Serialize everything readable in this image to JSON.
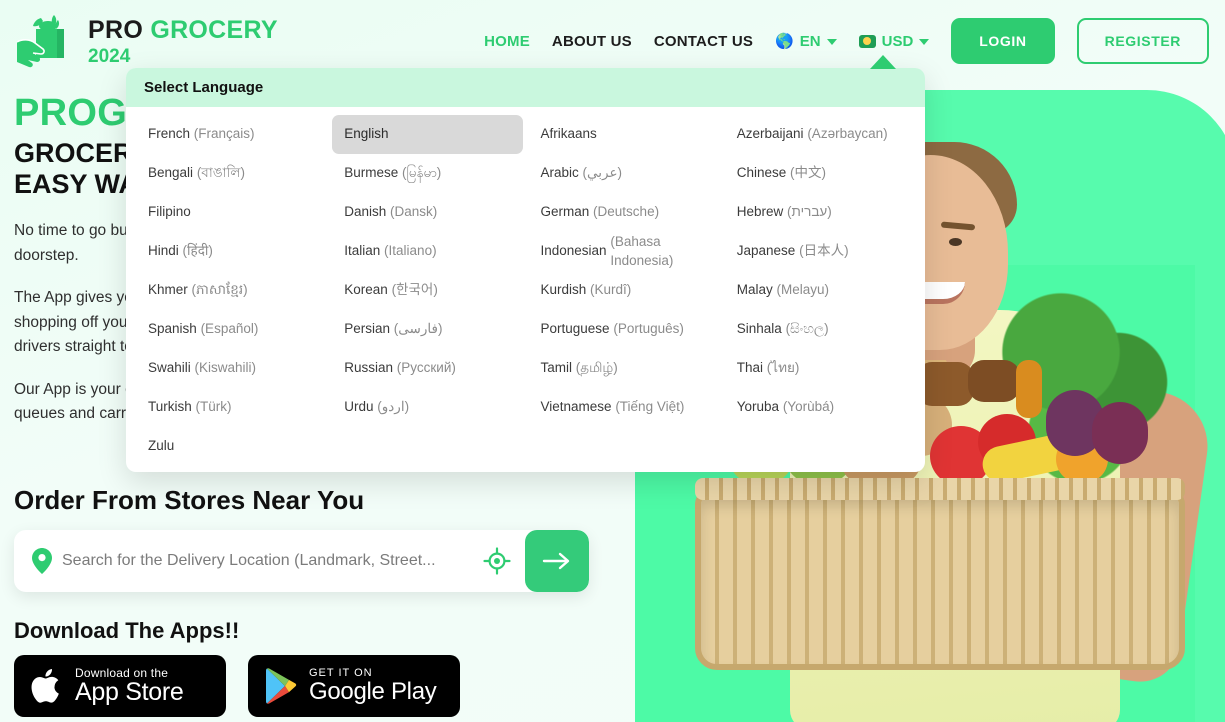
{
  "brand": {
    "logo_icon": "grocery-bag-handshake-icon",
    "name_part1": "PRO",
    "name_part2": "GROCERY",
    "year": "2024"
  },
  "nav": {
    "links": [
      {
        "label": "HOME",
        "active": true
      },
      {
        "label": "ABOUT US",
        "active": false
      },
      {
        "label": "CONTACT US",
        "active": false
      }
    ],
    "language_selector": {
      "icon": "globe-icon",
      "value": "EN",
      "caret": "chevron-down-icon"
    },
    "currency_selector": {
      "icon": "coin-icon",
      "value": "USD",
      "caret": "chevron-down-icon"
    },
    "login_label": "LOGIN",
    "register_label": "REGISTER"
  },
  "language_dropdown": {
    "title": "Select Language",
    "selected": "English",
    "items": [
      {
        "name": "French",
        "native": "(Français)"
      },
      {
        "name": "English",
        "native": ""
      },
      {
        "name": "Afrikaans",
        "native": ""
      },
      {
        "name": "Azerbaijani",
        "native": "(Azərbaycan)"
      },
      {
        "name": "Bengali",
        "native": "(বাঙালি)"
      },
      {
        "name": "Burmese",
        "native": "(မြန်မာ)"
      },
      {
        "name": "Arabic",
        "native": "(عربي)"
      },
      {
        "name": "Chinese",
        "native": "(中文)"
      },
      {
        "name": "Filipino",
        "native": ""
      },
      {
        "name": "Danish",
        "native": "(Dansk)"
      },
      {
        "name": "German",
        "native": "(Deutsche)"
      },
      {
        "name": "Hebrew",
        "native": "(עברית)"
      },
      {
        "name": "Hindi",
        "native": "(हिंदी)"
      },
      {
        "name": "Italian",
        "native": "(Italiano)"
      },
      {
        "name": "Indonesian",
        "native": "(Bahasa Indonesia)"
      },
      {
        "name": "Japanese",
        "native": "(日本人)"
      },
      {
        "name": "Khmer",
        "native": "(ភាសាខ្មែរ)"
      },
      {
        "name": "Korean",
        "native": "(한국어)"
      },
      {
        "name": "Kurdish",
        "native": "(Kurdî)"
      },
      {
        "name": "Malay",
        "native": "(Melayu)"
      },
      {
        "name": "Spanish",
        "native": "(Español)"
      },
      {
        "name": "Persian",
        "native": "(فارسی)"
      },
      {
        "name": "Portuguese",
        "native": "(Português)"
      },
      {
        "name": "Sinhala",
        "native": "(සිංහල)"
      },
      {
        "name": "Swahili",
        "native": "(Kiswahili)"
      },
      {
        "name": "Russian",
        "native": "(Русский)"
      },
      {
        "name": "Tamil",
        "native": "(தமிழ்)"
      },
      {
        "name": "Thai",
        "native": "(ไทย)"
      },
      {
        "name": "Turkish",
        "native": "(Türk)"
      },
      {
        "name": "Urdu",
        "native": "(اردو)"
      },
      {
        "name": "Vietnamese",
        "native": "(Tiếng Việt)"
      },
      {
        "name": "Yoruba",
        "native": "(Yorùbá)"
      },
      {
        "name": "Zulu",
        "native": ""
      }
    ]
  },
  "hero": {
    "title_line1": "PROGROCERY",
    "title_line2": "GROCERIES DELIVERED THE EASY WAY",
    "paragraph1": "No time to go buy groceries? Sit back, relax and get Groceries delivered to your doorstep.",
    "paragraph2": "The App gives you time to do other things. Life can be busy, so let us take the shopping off your weekend. Picked fresh by our shoppers, driven by friendly drivers straight to your door.",
    "paragraph3": "Our App is your one stop shop for all your grocery shopping. Say goodbye to long queues and carrying heavy bags. Enjoy the convenience today."
  },
  "order_section": {
    "heading": "Order From Stores Near You",
    "search": {
      "pin_icon": "location-pin-icon",
      "placeholder": "Search for the Delivery Location (Landmark, Street...",
      "value": "",
      "gps_icon": "crosshair-gps-icon",
      "submit_icon": "arrow-right-icon"
    }
  },
  "download_section": {
    "heading": "Download The Apps!!",
    "app_store": {
      "icon": "apple-icon",
      "small": "Download on the",
      "big": "App Store"
    },
    "google_play": {
      "icon": "google-play-icon",
      "small": "GET IT ON",
      "big": "Google Play"
    }
  },
  "colors": {
    "brand_green": "#2ecc71",
    "accent_green": "#57fbad",
    "page_bg": "#eafdf3",
    "dropdown_header_bg": "#c9f7de",
    "selected_item_bg": "#d9d9d9"
  }
}
